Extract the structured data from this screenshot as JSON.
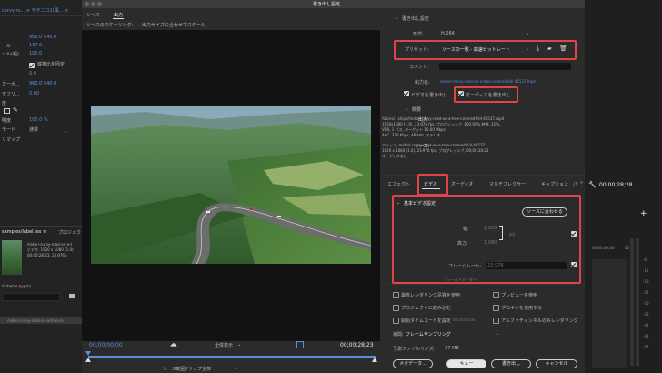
{
  "window": {
    "title": "書き出し設定"
  },
  "left_panel": {
    "header": "carvy-ro... ≡ モザニコ1(風... ≡",
    "rows": [
      {
        "label": "",
        "value": ""
      },
      {
        "label": "",
        "value": "960.0   540.0"
      },
      {
        "label": "ール",
        "value": "137.0"
      },
      {
        "label": "ール(幅)",
        "value": "100.0"
      },
      {
        "label": "",
        "value": "縦横比を固定"
      },
      {
        "label": "",
        "value": "0.0"
      },
      {
        "label": "カーポ...",
        "value": "960.0   540.0"
      },
      {
        "label": "チフリ...",
        "value": "0.00"
      },
      {
        "label": "度",
        "value": ""
      },
      {
        "label": "明度",
        "value": "100.0 %"
      },
      {
        "label": "モード",
        "value": "通常"
      },
      {
        "label": "リマップ",
        "value": ""
      }
    ],
    "project_tab": "samples/label.lex ≡",
    "project_tab2": "プロジェク",
    "clip_name": "midori-curvy-road-on-a-t",
    "clip_info1": "ビデオ, 1920 x 1080 (1.0)",
    "clip_info2": "00;00;28;23, 23.976p",
    "path_label": "/Lube(ne.pypro)",
    "bottom_clip": "midori-curvy-road-on-a-tree-co"
  },
  "source_tabs": {
    "source": "ソース",
    "output": "出力"
  },
  "scaling": {
    "label": "ソースのスケーリング:",
    "value": "出力サイズに合わせてスケール"
  },
  "timeline": {
    "time_start": "00;00;00;00",
    "time_end": "00;00;28;23",
    "fit_label": "全体表示",
    "source_range_label": "ソース範囲:",
    "source_range_value": "クリップ全体"
  },
  "export": {
    "section_title": "書き出し設定",
    "format_label": "形式:",
    "format_value": "H.264",
    "preset_label": "プリセット:",
    "preset_value": "ソースの一致 - 高速ビットレート",
    "comment_label": "コメント:",
    "output_name_label": "出力名:",
    "output_name_value": "midori-curvy-road-on-a-tree-covered-hill-41537.mp4",
    "export_video": "ビデオを書き出し",
    "export_audio": "オーディオを書き出し",
    "summary_title": "概要",
    "output_label": "出力:",
    "output_lines": [
      "/Users/...ships/midori-curvy-road-on-a-tree-covered-hill-41537.mp4",
      "1920x1080 (1.0), 23.976 fps, プログレッシブ, 100.00% 時間, 31%..",
      "VBR, 1 パス, ターゲット 10.00 Mbps",
      "AAC, 320 Kbps, 48 kHz, ステレオ"
    ],
    "source_label": "ソース:",
    "source_lines": [
      "クリップ, midori-curvy-road-on-a-tree-covered-hill-41537",
      "1920 x 1080 (1.0), 23.976 fps, プログレッシブ, 00;00;28;23",
      "オーディオなし"
    ]
  },
  "tabs": [
    "エフェクト",
    "ビデオ",
    "オーディオ",
    "マルチプレクサー",
    "キャプション",
    "パ"
  ],
  "video_settings": {
    "title": "基本ビデオ設定",
    "match_source": "ソースに合わせる",
    "width_label": "幅:",
    "width_value": "1,920",
    "height_label": "高さ:",
    "height_value": "1,080",
    "px": "px",
    "frame_rate_label": "フレームレート:",
    "frame_rate_value": "23.976",
    "field_order_label": "フィールドオーダー:"
  },
  "options": {
    "max_render": "最高レンダリング品質を使用",
    "use_preview": "プレビューを使用",
    "import_project": "プロジェクトに読み込む",
    "use_proxy": "プロキシを使用する",
    "set_timecode": "開始タイムコードを設定",
    "timecode_value": "00;00;00;00",
    "alpha_render": "アルファチャンネルのみレンダリング",
    "interp_label": "補間:",
    "interp_value": "フレームサンプリング",
    "filesize_label": "予測ファイルサイズ:",
    "filesize_value": "37 MB"
  },
  "buttons": {
    "metadata": "メタデータ...",
    "queue": "キュー",
    "export": "書き出し",
    "cancel": "キャンセル"
  },
  "right_panel": {
    "timecode": "00;00;28;28",
    "ruler": "00;00;00;00",
    "ruler2": "00",
    "meter": [
      "-6",
      "-12",
      "-18",
      "-24",
      "-30",
      "-36",
      "-42",
      "-48",
      "-54"
    ]
  }
}
